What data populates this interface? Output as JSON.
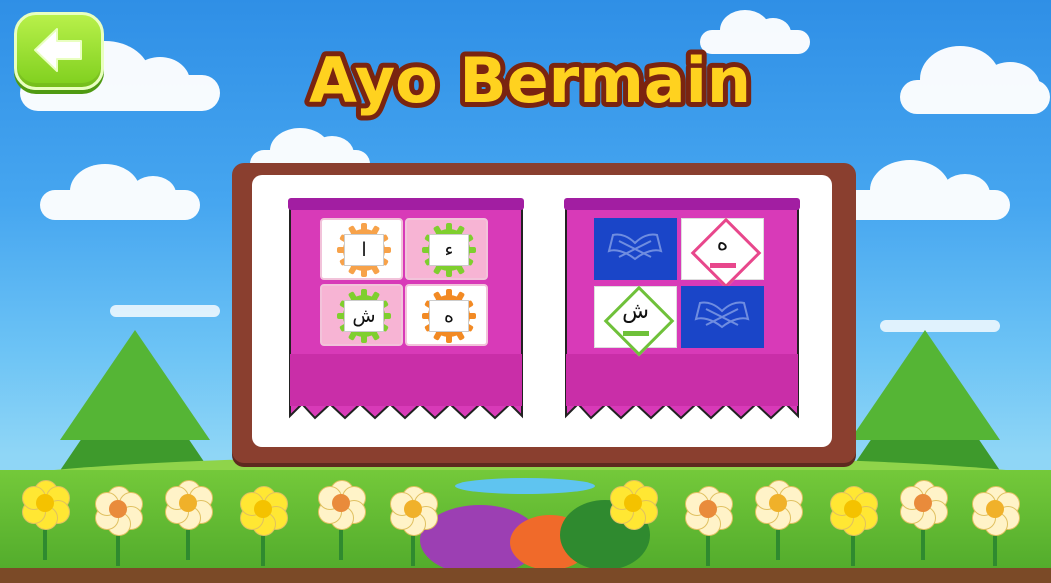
{
  "header": {
    "title": "Ayo Bermain",
    "back_label": "back"
  },
  "colors": {
    "title_fill": "#ffd21f",
    "title_stroke": "#7a2410",
    "banner": "#d83ab8",
    "banner_dark": "#a21ea2",
    "board_frame": "#8a3f2f",
    "back_button": "#9be02d"
  },
  "games": [
    {
      "name": "match-card-game",
      "tiles": [
        {
          "letter": "ا",
          "color": "#f7a24a"
        },
        {
          "letter": "ء",
          "color": "#7fcf2e"
        },
        {
          "letter": "ش",
          "color": "#7fcf2e"
        },
        {
          "letter": "ه",
          "color": "#f28a24"
        }
      ]
    },
    {
      "name": "memory-card-game",
      "tiles": [
        {
          "type": "book-icon"
        },
        {
          "type": "letter",
          "letter": "ه",
          "color": "#e8478c"
        },
        {
          "type": "letter",
          "letter": "ش",
          "color": "#6fc13a"
        },
        {
          "type": "book-icon"
        }
      ]
    }
  ],
  "icons": {
    "back": "arrow-left-icon",
    "book": "open-book-icon"
  }
}
